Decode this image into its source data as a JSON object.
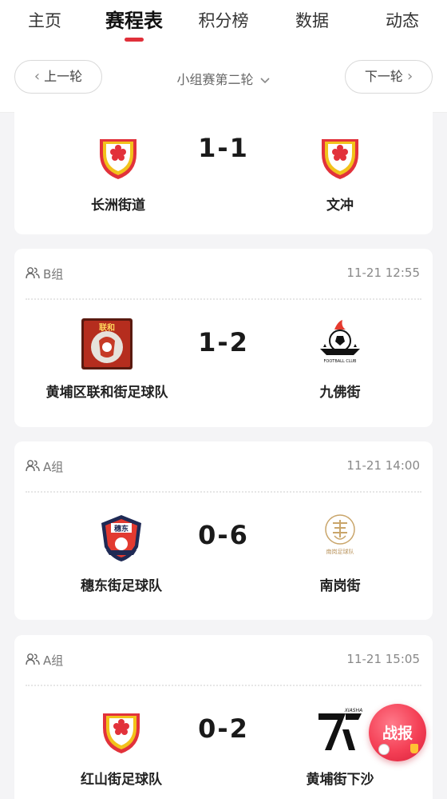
{
  "tabs": [
    {
      "label": "主页"
    },
    {
      "label": "赛程表"
    },
    {
      "label": "积分榜"
    },
    {
      "label": "数据"
    },
    {
      "label": "动态"
    }
  ],
  "active_tab": "赛程表",
  "round_nav": {
    "prev_label": "上一轮",
    "title": "小组赛第二轮",
    "next_label": "下一轮"
  },
  "matches": [
    {
      "group": "",
      "time": "",
      "home": {
        "name": "长洲街道"
      },
      "score": "1-1",
      "away": {
        "name": "文冲"
      }
    },
    {
      "group": "B组",
      "time": "11-21 12:55",
      "home": {
        "name": "黄埔区联和街足球队",
        "logo_text": "联和"
      },
      "score": "1-2",
      "away": {
        "name": "九佛街",
        "logo_text": "FOOTBALL CLUB"
      }
    },
    {
      "group": "A组",
      "time": "11-21 14:00",
      "home": {
        "name": "穗东街足球队",
        "logo_text": "穗东"
      },
      "score": "0-6",
      "away": {
        "name": "南岗街",
        "logo_text": "南岗足球队"
      }
    },
    {
      "group": "A组",
      "time": "11-21 15:05",
      "home": {
        "name": "红山街足球队"
      },
      "score": "0-2",
      "away": {
        "name": "黄埔街下沙",
        "logo_text": "XIASHA"
      }
    }
  ],
  "float_button": {
    "label": "战报"
  },
  "colors": {
    "accent_red": "#e0303a",
    "shield_yellow": "#f2c21b",
    "shield_red": "#e2323b",
    "card_bg": "#ffffff",
    "page_bg": "#f4f4f6"
  }
}
